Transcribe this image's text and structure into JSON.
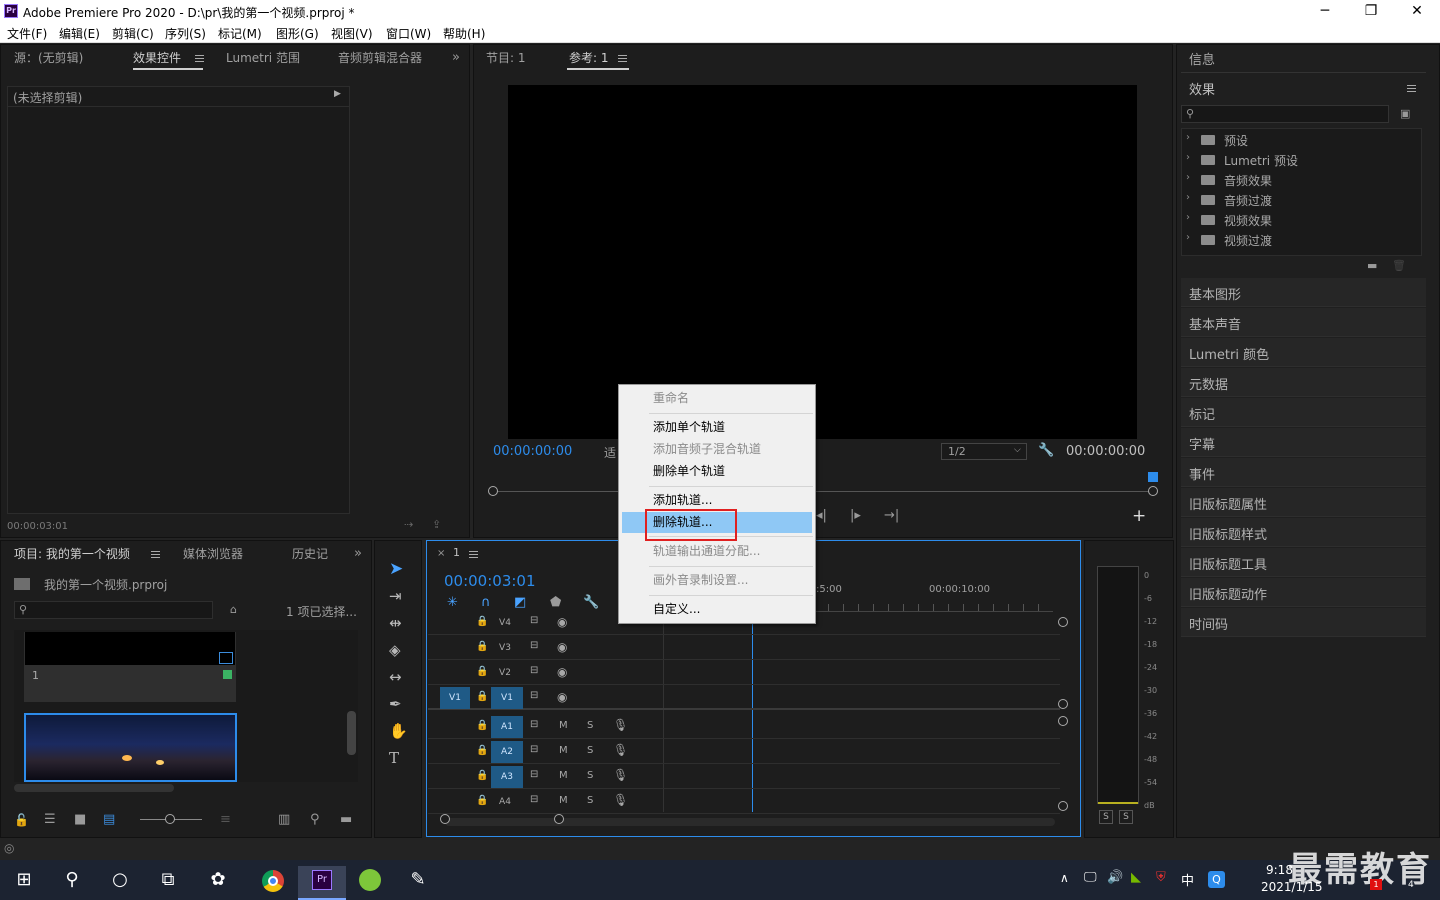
{
  "app": {
    "window_title": "Adobe Premiere Pro 2020 - D:\\pr\\我的第一个视频.prproj *",
    "logo_text": "Pr"
  },
  "menu": [
    "文件(F)",
    "编辑(E)",
    "剪辑(C)",
    "序列(S)",
    "标记(M)",
    "图形(G)",
    "视图(V)",
    "窗口(W)",
    "帮助(H)"
  ],
  "source_panel": {
    "tabs": [
      "源：(无剪辑)",
      "效果控件",
      "Lumetri 范围",
      "音频剪辑混合器"
    ],
    "active_tab": "效果控件",
    "no_clip_text": "(未选择剪辑)",
    "timecode": "00:00:03:01"
  },
  "program_panel": {
    "tabs": [
      "节目: 1",
      "参考: 1"
    ],
    "active_tab": "参考: 1",
    "timecode_left": "00:00:00:00",
    "fit_label": "适",
    "resolution": "1/2",
    "timecode_right": "00:00:00:00"
  },
  "project_panel": {
    "tabs": [
      "项目: 我的第一个视频",
      "媒体浏览器",
      "历史记"
    ],
    "file_name": "我的第一个视频.prproj",
    "selected_count": "1 项已选择...",
    "clip1_label": "1"
  },
  "timeline": {
    "sequence_name": "1",
    "timecode": "00:00:03:01",
    "ruler_labels": [
      ":5:00",
      "00:00:10:00"
    ],
    "video_tracks": [
      "V4",
      "V3",
      "V2",
      "V1"
    ],
    "audio_tracks": [
      "A1",
      "A2",
      "A3",
      "A4"
    ],
    "source_patch": "V1",
    "mute_label": "M",
    "solo_label": "S"
  },
  "audio_meter": {
    "scale": [
      "0",
      "-6",
      "-12",
      "-18",
      "-24",
      "-30",
      "-36",
      "-42",
      "-48",
      "-54",
      "dB"
    ],
    "solo_buttons": [
      "S",
      "S"
    ]
  },
  "context_menu": {
    "items": [
      {
        "label": "重命名",
        "enabled": false
      },
      {
        "label": "添加单个轨道",
        "enabled": true
      },
      {
        "label": "添加音频子混合轨道",
        "enabled": false
      },
      {
        "label": "删除单个轨道",
        "enabled": true
      },
      {
        "label": "添加轨道...",
        "enabled": true
      },
      {
        "label": "删除轨道...",
        "enabled": true,
        "highlighted": true
      },
      {
        "label": "轨道输出通道分配...",
        "enabled": false
      },
      {
        "label": "画外音录制设置...",
        "enabled": false
      },
      {
        "label": "自定义...",
        "enabled": true
      }
    ]
  },
  "right_panel": {
    "info_title": "信息",
    "effects_title": "效果",
    "effects_tree": [
      "预设",
      "Lumetri 预设",
      "音频效果",
      "音频过渡",
      "视频效果",
      "视频过渡"
    ],
    "collapsed_panels": [
      "基本图形",
      "基本声音",
      "Lumetri 颜色",
      "元数据",
      "标记",
      "字幕",
      "事件",
      "旧版标题属性",
      "旧版标题样式",
      "旧版标题工具",
      "旧版标题动作",
      "时间码"
    ]
  },
  "taskbar": {
    "time": "9:18",
    "date": "2021/1/15",
    "ime": "中",
    "watermark": "最需教育",
    "notification_badge": "1",
    "notification_count": "4"
  },
  "colors": {
    "accent_blue": "#2d8ceb",
    "highlight": "#8fc8f5",
    "annotation_red": "#e02020",
    "track_blue": "#1f5a86"
  }
}
